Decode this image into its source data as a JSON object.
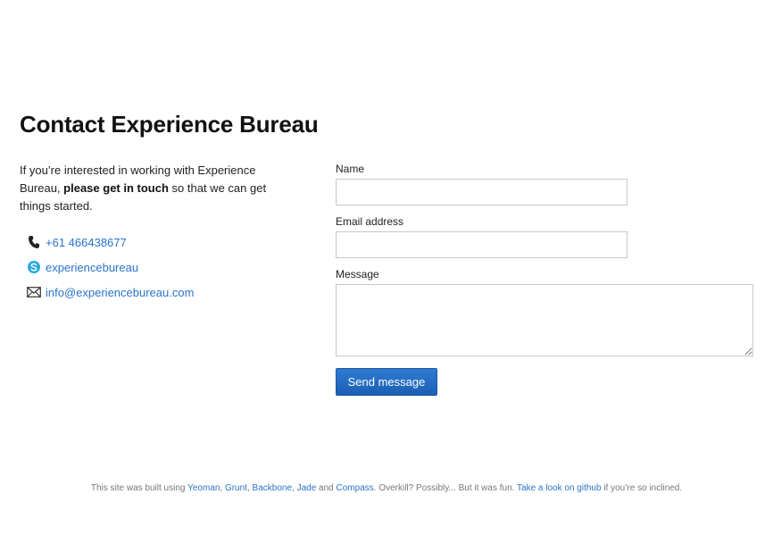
{
  "title": "Contact Experience Bureau",
  "intro": {
    "before": "If you’re interested in working with Experience Bureau,",
    "bold": "please get in touch",
    "after": "so that we can get things started."
  },
  "contacts": {
    "phone": {
      "icon": "phone-icon",
      "text": "+61 466438677"
    },
    "skype": {
      "icon": "skype-icon",
      "text": "experiencebureau"
    },
    "email": {
      "icon": "envelope-icon",
      "text": "info@experiencebureau.com"
    }
  },
  "form": {
    "name_label": "Name",
    "name_value": "",
    "email_label": "Email address",
    "email_value": "",
    "message_label": "Message",
    "message_value": "",
    "submit_label": "Send message"
  },
  "footer": {
    "prefix": "This site was built using",
    "links": [
      "Yeoman",
      "Grunt",
      "Backbone",
      "Jade"
    ],
    "and": "and",
    "last_link": "Compass",
    "middle": ". Overkill? Possibly... But it was fun.",
    "github_link": "Take a look on github",
    "suffix": "if you’re so inclined."
  },
  "colors": {
    "link": "#2a73c9",
    "button": "#1a5fb4",
    "skype": "#29a9e0"
  }
}
